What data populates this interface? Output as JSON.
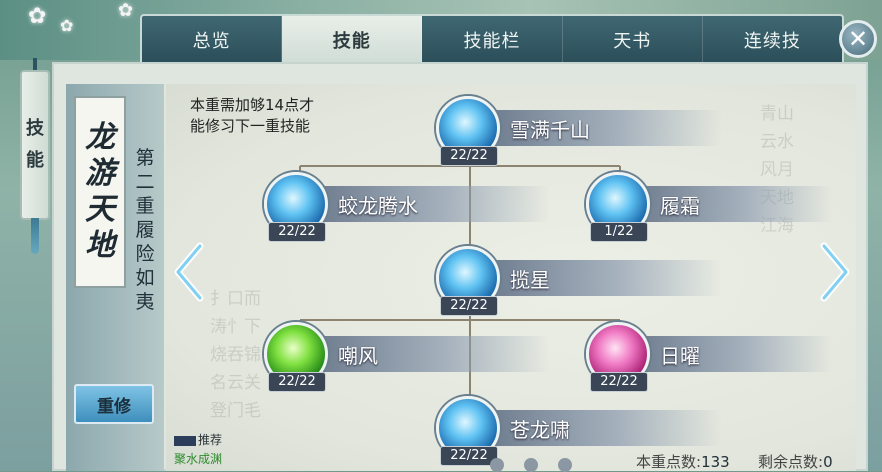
{
  "tabs": [
    {
      "label": "总览",
      "active": false
    },
    {
      "label": "技能",
      "active": true
    },
    {
      "label": "技能栏",
      "active": false
    },
    {
      "label": "天书",
      "active": false
    },
    {
      "label": "连续技",
      "active": false
    }
  ],
  "close_label": "✕",
  "side_tag": {
    "chars": [
      "技",
      "能"
    ]
  },
  "school": {
    "title_chars": [
      "龙",
      "游",
      "天",
      "地"
    ],
    "subtitle_chars": [
      "第",
      "二",
      "重",
      "履",
      "险",
      "如",
      "夷"
    ]
  },
  "redo_button": "重修",
  "recommend": {
    "label": "推荐",
    "value": "聚水成渊"
  },
  "requirement_lines": [
    "本重需加够14点才",
    "能修习下一重技能"
  ],
  "skills": [
    {
      "name": "雪满千山",
      "level": "22/22",
      "style": "ice"
    },
    {
      "name": "蛟龙腾水",
      "level": "22/22",
      "style": "ice"
    },
    {
      "name": "履霜",
      "level": "1/22",
      "style": "ice"
    },
    {
      "name": "揽星",
      "level": "22/22",
      "style": "ice"
    },
    {
      "name": "嘲风",
      "level": "22/22",
      "style": "green"
    },
    {
      "name": "日曜",
      "level": "22/22",
      "style": "pink"
    },
    {
      "name": "苍龙啸",
      "level": "22/22",
      "style": "ice"
    }
  ],
  "stats": {
    "current_label": "本重点数:",
    "current_value": "133",
    "remaining_label": "剩余点数:",
    "remaining_value": "0"
  },
  "pager": {
    "pages": 3
  }
}
